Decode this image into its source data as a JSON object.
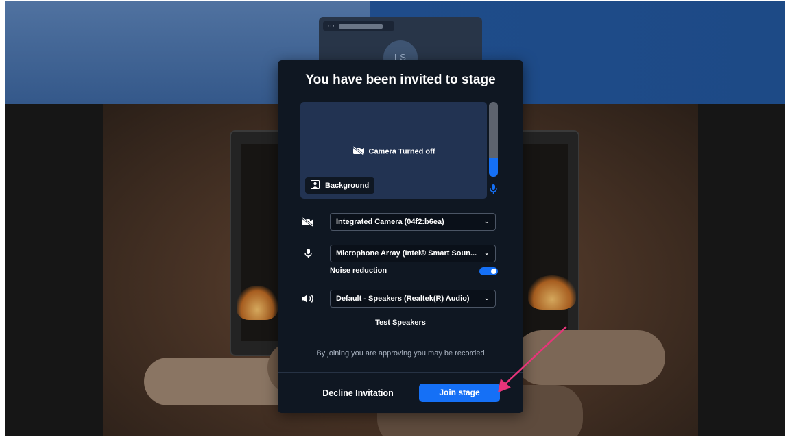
{
  "background": {
    "participant_initials": "LS",
    "participant_name_prefix": "···"
  },
  "modal": {
    "title": "You have been invited to stage",
    "preview": {
      "camera_status": "Camera Turned off",
      "background_button": "Background",
      "mic_level": 0.25
    },
    "devices": {
      "camera": "Integrated Camera (04f2:b6ea)",
      "microphone": "Microphone Array (Intel® Smart Soun...",
      "speaker": "Default - Speakers (Realtek(R) Audio)"
    },
    "noise_reduction_label": "Noise reduction",
    "noise_reduction_enabled": true,
    "test_speakers": "Test Speakers",
    "recording_notice": "By joining you are approving you may be recorded",
    "decline_button": "Decline Invitation",
    "join_button": "Join stage"
  },
  "colors": {
    "accent": "#1570f6",
    "modal_bg": "#0f1722",
    "preview_bg": "#223352",
    "annotation_arrow": "#e8347a"
  },
  "icons": {
    "camera_off": "camera-off-icon",
    "microphone": "microphone-icon",
    "speaker": "speaker-icon",
    "background": "background-icon",
    "chevron": "chevron-down-icon"
  }
}
